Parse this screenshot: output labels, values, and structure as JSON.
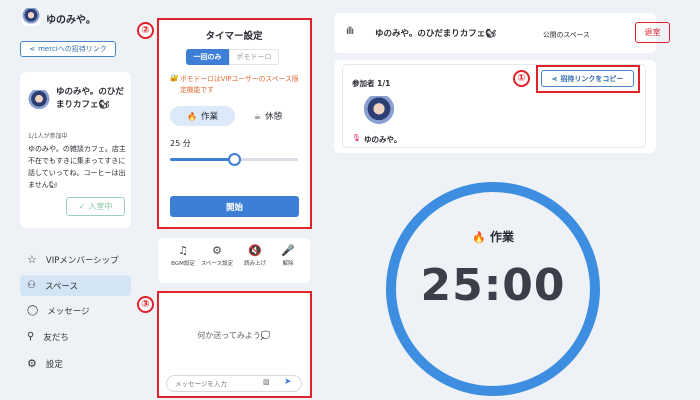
{
  "user": {
    "name": "ゆのみや。"
  },
  "invite_button": {
    "label": "merciへの招待リンク"
  },
  "space_card": {
    "title": "ゆのみや。のひだまりカフェ🐿",
    "members": "1/1人が参加中",
    "description": "ゆのみや。の雑談カフェ。店主不在でもすきに集まってすきに話していってね。コーヒーは出ません🐿",
    "join_label": "入室中"
  },
  "nav": {
    "vip": "VIPメンバーシップ",
    "space": "スペース",
    "message": "メッセージ",
    "friends": "友だち",
    "settings": "設定"
  },
  "timer_settings": {
    "title": "タイマー設定",
    "tab_once": "一回のみ",
    "tab_pomodoro": "ポモドーロ",
    "notice": "ポモドーロはVIPユーザーのスペース限定機能です",
    "mode_work": "作業",
    "mode_break": "休憩",
    "minutes_label": "25 分",
    "slider_fraction": 0.5,
    "start_label": "開始"
  },
  "tools": [
    {
      "label": "BGM設定",
      "icon": "music-icon"
    },
    {
      "label": "スペース設定",
      "icon": "gears-icon"
    },
    {
      "label": "読み上げ",
      "icon": "speaker-muted-icon"
    },
    {
      "label": "解除",
      "icon": "mic-off-icon"
    }
  ],
  "chat": {
    "empty_hint": "何か送ってみよう💭",
    "placeholder": "メッセージを入力"
  },
  "space_header": {
    "title": "ゆのみや。のひだまりカフェ🐿",
    "visibility": "公開のスペース",
    "leave_label": "退室"
  },
  "participants": {
    "label": "参加者 1/1",
    "copy_link_label": "招待リンクをコピー",
    "member_name": "ゆのみや。"
  },
  "timer": {
    "mode_label": "作業",
    "time": "25:00"
  },
  "annotations": [
    "①",
    "②",
    "③"
  ],
  "colors": {
    "accent": "#3d7fd6",
    "ring": "#3d8ee0",
    "highlight": "#e0232b"
  }
}
